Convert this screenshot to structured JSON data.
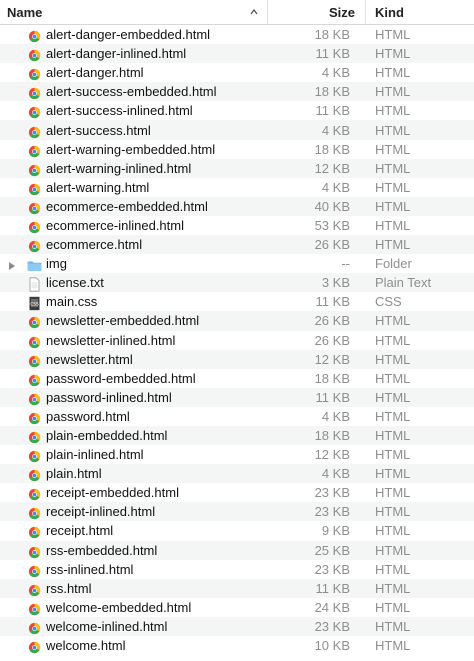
{
  "header": {
    "name": "Name",
    "size": "Size",
    "kind": "Kind"
  },
  "files": [
    {
      "name": "alert-danger-embedded.html",
      "size": "18 KB",
      "kind": "HTML",
      "icon": "chrome-html-icon"
    },
    {
      "name": "alert-danger-inlined.html",
      "size": "11 KB",
      "kind": "HTML",
      "icon": "chrome-html-icon"
    },
    {
      "name": "alert-danger.html",
      "size": "4 KB",
      "kind": "HTML",
      "icon": "chrome-html-icon"
    },
    {
      "name": "alert-success-embedded.html",
      "size": "18 KB",
      "kind": "HTML",
      "icon": "chrome-html-icon"
    },
    {
      "name": "alert-success-inlined.html",
      "size": "11 KB",
      "kind": "HTML",
      "icon": "chrome-html-icon"
    },
    {
      "name": "alert-success.html",
      "size": "4 KB",
      "kind": "HTML",
      "icon": "chrome-html-icon"
    },
    {
      "name": "alert-warning-embedded.html",
      "size": "18 KB",
      "kind": "HTML",
      "icon": "chrome-html-icon"
    },
    {
      "name": "alert-warning-inlined.html",
      "size": "12 KB",
      "kind": "HTML",
      "icon": "chrome-html-icon"
    },
    {
      "name": "alert-warning.html",
      "size": "4 KB",
      "kind": "HTML",
      "icon": "chrome-html-icon"
    },
    {
      "name": "ecommerce-embedded.html",
      "size": "40 KB",
      "kind": "HTML",
      "icon": "chrome-html-icon"
    },
    {
      "name": "ecommerce-inlined.html",
      "size": "53 KB",
      "kind": "HTML",
      "icon": "chrome-html-icon"
    },
    {
      "name": "ecommerce.html",
      "size": "26 KB",
      "kind": "HTML",
      "icon": "chrome-html-icon"
    },
    {
      "name": "img",
      "size": "--",
      "kind": "Folder",
      "icon": "folder-icon",
      "folder": true
    },
    {
      "name": "license.txt",
      "size": "3 KB",
      "kind": "Plain Text",
      "icon": "text-file-icon"
    },
    {
      "name": "main.css",
      "size": "11 KB",
      "kind": "CSS",
      "icon": "css-file-icon"
    },
    {
      "name": "newsletter-embedded.html",
      "size": "26 KB",
      "kind": "HTML",
      "icon": "chrome-html-icon"
    },
    {
      "name": "newsletter-inlined.html",
      "size": "26 KB",
      "kind": "HTML",
      "icon": "chrome-html-icon"
    },
    {
      "name": "newsletter.html",
      "size": "12 KB",
      "kind": "HTML",
      "icon": "chrome-html-icon"
    },
    {
      "name": "password-embedded.html",
      "size": "18 KB",
      "kind": "HTML",
      "icon": "chrome-html-icon"
    },
    {
      "name": "password-inlined.html",
      "size": "11 KB",
      "kind": "HTML",
      "icon": "chrome-html-icon"
    },
    {
      "name": "password.html",
      "size": "4 KB",
      "kind": "HTML",
      "icon": "chrome-html-icon"
    },
    {
      "name": "plain-embedded.html",
      "size": "18 KB",
      "kind": "HTML",
      "icon": "chrome-html-icon"
    },
    {
      "name": "plain-inlined.html",
      "size": "12 KB",
      "kind": "HTML",
      "icon": "chrome-html-icon"
    },
    {
      "name": "plain.html",
      "size": "4 KB",
      "kind": "HTML",
      "icon": "chrome-html-icon"
    },
    {
      "name": "receipt-embedded.html",
      "size": "23 KB",
      "kind": "HTML",
      "icon": "chrome-html-icon"
    },
    {
      "name": "receipt-inlined.html",
      "size": "23 KB",
      "kind": "HTML",
      "icon": "chrome-html-icon"
    },
    {
      "name": "receipt.html",
      "size": "9 KB",
      "kind": "HTML",
      "icon": "chrome-html-icon"
    },
    {
      "name": "rss-embedded.html",
      "size": "25 KB",
      "kind": "HTML",
      "icon": "chrome-html-icon"
    },
    {
      "name": "rss-inlined.html",
      "size": "23 KB",
      "kind": "HTML",
      "icon": "chrome-html-icon"
    },
    {
      "name": "rss.html",
      "size": "11 KB",
      "kind": "HTML",
      "icon": "chrome-html-icon"
    },
    {
      "name": "welcome-embedded.html",
      "size": "24 KB",
      "kind": "HTML",
      "icon": "chrome-html-icon"
    },
    {
      "name": "welcome-inlined.html",
      "size": "23 KB",
      "kind": "HTML",
      "icon": "chrome-html-icon"
    },
    {
      "name": "welcome.html",
      "size": "10 KB",
      "kind": "HTML",
      "icon": "chrome-html-icon"
    }
  ]
}
